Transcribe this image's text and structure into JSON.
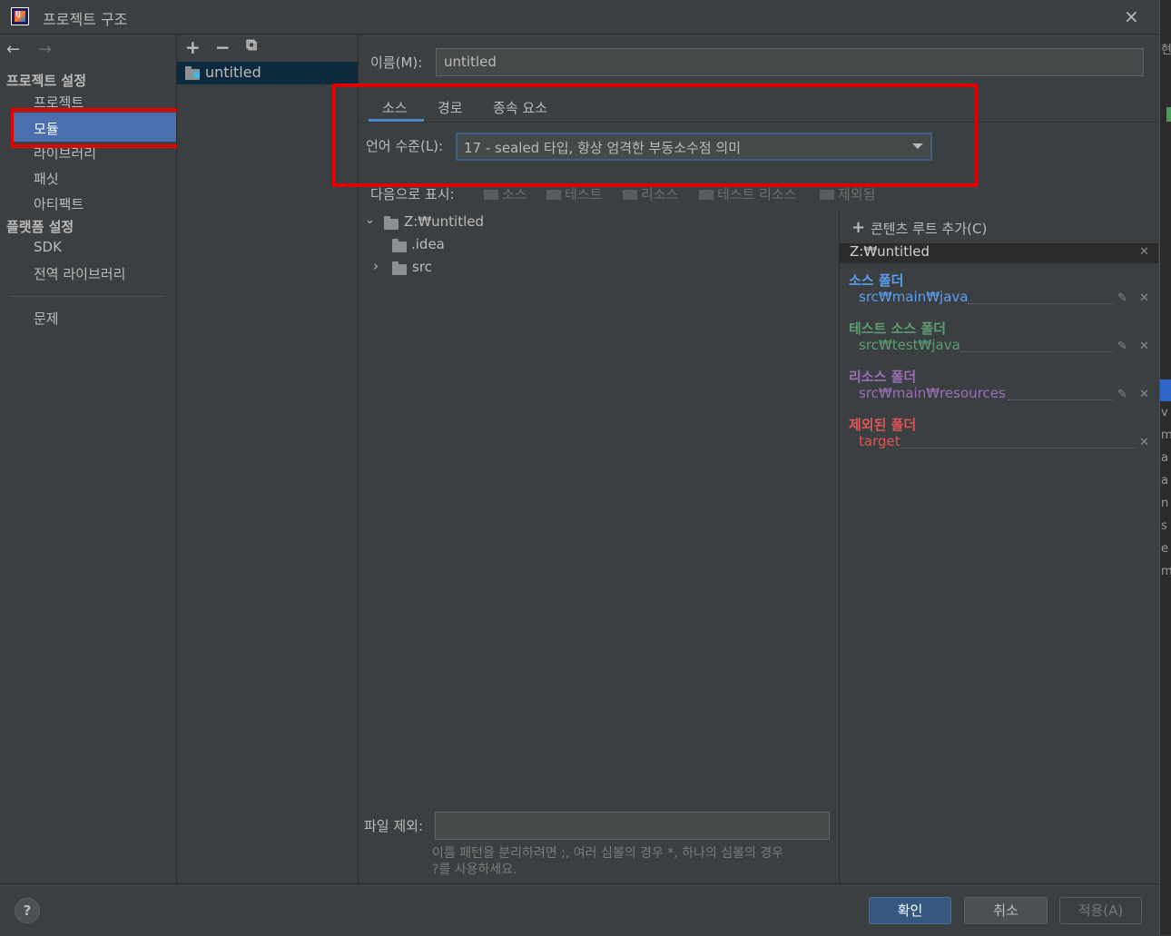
{
  "window": {
    "title": "프로젝트 구조",
    "close": "×"
  },
  "nav": {
    "back": "←",
    "forward": "→",
    "project_settings_header": "프로젝트 설정",
    "project_settings": [
      "프로젝트",
      "모듈",
      "라이브러리",
      "패싯",
      "아티팩트"
    ],
    "platform_settings_header": "플랫폼 설정",
    "platform_settings": [
      "SDK",
      "전역 라이브러리"
    ],
    "problems": "문제",
    "selected": "모듈"
  },
  "modules": {
    "add": "+",
    "remove": "−",
    "copy": "⧉",
    "items": [
      "untitled"
    ]
  },
  "detail": {
    "name_label": "이름(M):",
    "name_value": "untitled",
    "tabs": [
      "소스",
      "경로",
      "종속 요소"
    ],
    "active_tab": "소스",
    "language_level_label": "언어 수준(L):",
    "language_level_value": "17 - sealed 타입, 항상 엄격한 부동소수점 의미",
    "mark_as_label": "다음으로 표시:",
    "mark_as": [
      "소스",
      "테스트",
      "리소스",
      "테스트 리소스",
      "제외됨"
    ],
    "tree": {
      "root": "Z:₩untitled",
      "children": [
        ".idea",
        "src"
      ]
    },
    "exclude_label": "파일 제외:",
    "exclude_value": "",
    "exclude_hint_1": "이름 패턴을 분리하려면 ;, 여러 심볼의 경우 *, 하나의 심볼의 경우",
    "exclude_hint_2": "?를 사용하세요."
  },
  "content_roots": {
    "add_label": "콘텐츠 루트 추가(C)",
    "root_path": "Z:₩untitled",
    "groups": [
      {
        "label": "소스 폴더",
        "path": "src₩main₩java",
        "color": "#5c9ded"
      },
      {
        "label": "테스트 소스 폴더",
        "path": "src₩test₩java",
        "color": "#5a9e6f"
      },
      {
        "label": "리소스 폴더",
        "path": "src₩main₩resources",
        "color": "#9b6fb5"
      },
      {
        "label": "제외된 폴더",
        "path": "target",
        "color": "#e05555"
      }
    ]
  },
  "buttons": {
    "help": "?",
    "ok": "확인",
    "cancel": "취소",
    "apply": "적용(A)"
  },
  "background_window_chars": [
    "현",
    "v",
    "m",
    "a",
    "a",
    "n",
    "s",
    "e",
    "m"
  ]
}
